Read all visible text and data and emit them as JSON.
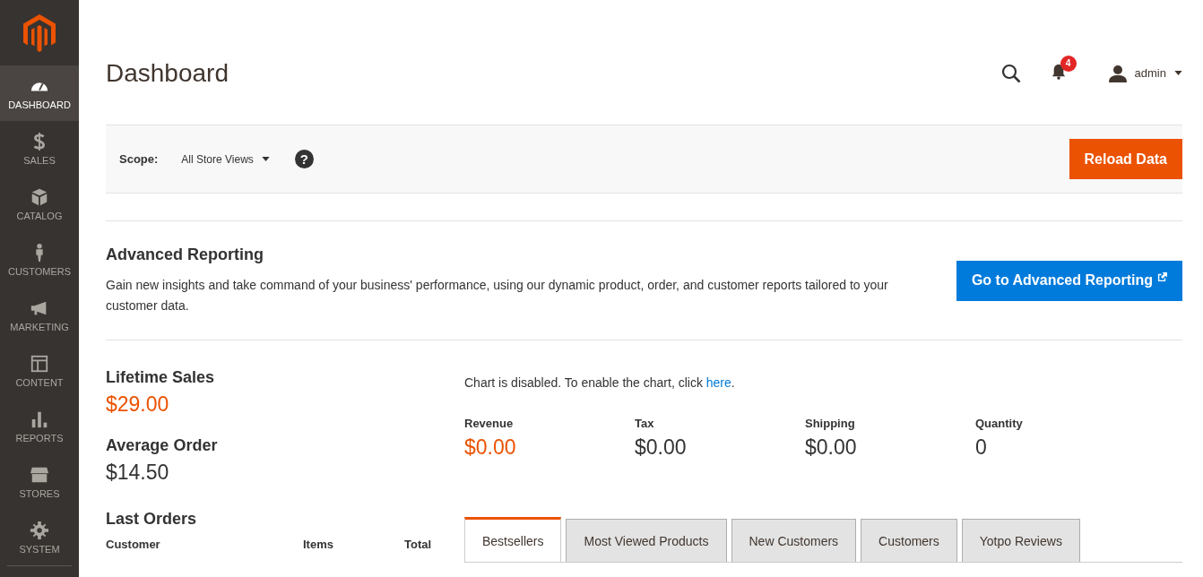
{
  "sidebar": {
    "items": [
      {
        "label": "DASHBOARD",
        "selected": true
      },
      {
        "label": "SALES",
        "selected": false
      },
      {
        "label": "CATALOG",
        "selected": false
      },
      {
        "label": "CUSTOMERS",
        "selected": false
      },
      {
        "label": "MARKETING",
        "selected": false
      },
      {
        "label": "CONTENT",
        "selected": false
      },
      {
        "label": "REPORTS",
        "selected": false
      },
      {
        "label": "STORES",
        "selected": false
      },
      {
        "label": "SYSTEM",
        "selected": false
      }
    ]
  },
  "header": {
    "title": "Dashboard",
    "notifications": "4",
    "user": "admin"
  },
  "scope": {
    "label": "Scope:",
    "value": "All Store Views",
    "help": "?",
    "button": "Reload Data"
  },
  "advanced_reporting": {
    "title": "Advanced Reporting",
    "text": "Gain new insights and take command of your business' performance, using our dynamic product, order, and customer reports tailored to your customer data.",
    "button": "Go to Advanced Reporting"
  },
  "summary": [
    {
      "label": "Lifetime Sales",
      "value": "$29.00",
      "color": "#eb5202"
    },
    {
      "label": "Average Order",
      "value": "$14.50",
      "color": "#333333"
    }
  ],
  "chart_notice": {
    "before": "Chart is disabled. To enable the chart, click ",
    "link": "here",
    "after": "."
  },
  "totals": [
    {
      "label": "Revenue",
      "value": "$0.00",
      "color": "#eb5202"
    },
    {
      "label": "Tax",
      "value": "$0.00",
      "color": "#333333"
    },
    {
      "label": "Shipping",
      "value": "$0.00",
      "color": "#333333"
    },
    {
      "label": "Quantity",
      "value": "0",
      "color": "#333333"
    }
  ],
  "last_orders": {
    "title": "Last Orders",
    "columns": [
      "Customer",
      "Items",
      "Total"
    ]
  },
  "tabs": [
    {
      "label": "Bestsellers",
      "selected": true
    },
    {
      "label": "Most Viewed Products",
      "selected": false
    },
    {
      "label": "New Customers",
      "selected": false
    },
    {
      "label": "Customers",
      "selected": false
    },
    {
      "label": "Yotpo Reviews",
      "selected": false
    }
  ]
}
